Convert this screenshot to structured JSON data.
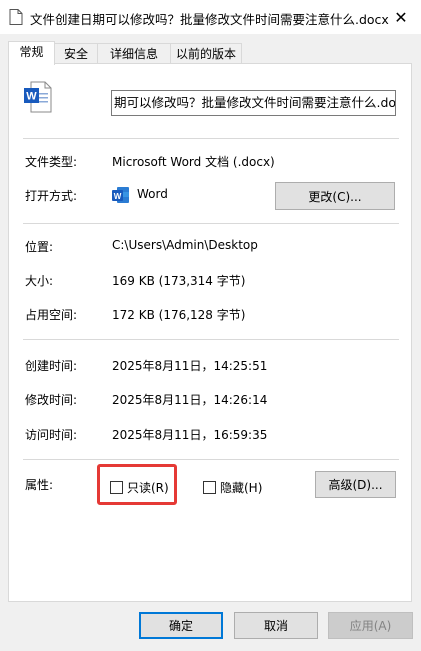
{
  "window": {
    "title": "文件创建日期可以修改吗？批量修改文件时间需要注意什么.docx",
    "close": "✕"
  },
  "tabs": [
    "常规",
    "安全",
    "详细信息",
    "以前的版本"
  ],
  "file": {
    "name": "期可以修改吗？批量修改文件时间需要注意什么.docx"
  },
  "general": {
    "type_label": "文件类型:",
    "type_value": "Microsoft Word 文档 (.docx)",
    "open_label": "打开方式:",
    "open_value": "Word",
    "change_button": "更改(C)...",
    "location_label": "位置:",
    "location_value": "C:\\Users\\Admin\\Desktop",
    "size_label": "大小:",
    "size_value": "169 KB (173,314 字节)",
    "disk_label": "占用空间:",
    "disk_value": "172 KB (176,128 字节)",
    "created_label": "创建时间:",
    "created_value": "2025年8月11日，14:25:51",
    "modified_label": "修改时间:",
    "modified_value": "2025年8月11日，14:26:14",
    "accessed_label": "访问时间:",
    "accessed_value": "2025年8月11日，16:59:35",
    "attr_label": "属性:",
    "readonly_label": "只读(R)",
    "hidden_label": "隐藏(H)",
    "advanced_button": "高级(D)..."
  },
  "footer": {
    "ok": "确定",
    "cancel": "取消",
    "apply": "应用(A)"
  },
  "colors": {
    "word_blue": "#185abd",
    "highlight_red": "#e53935",
    "focus_blue": "#0078d7"
  }
}
